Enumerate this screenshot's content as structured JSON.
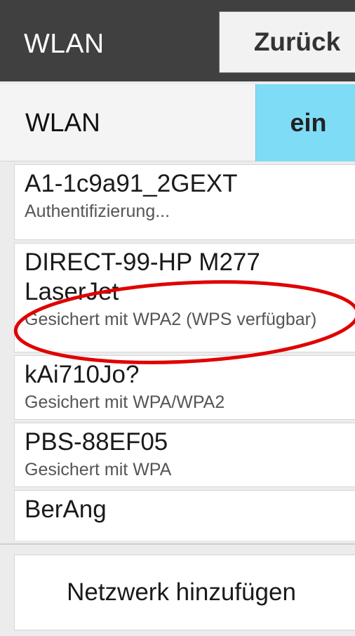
{
  "header": {
    "title": "WLAN",
    "back_label": "Zurück"
  },
  "wlan_toggle": {
    "label": "WLAN",
    "state_label": "ein",
    "accent_color": "#7fdcf6"
  },
  "networks": [
    {
      "name": "A1-1c9a91_2GEXT",
      "status": "Authentifizierung..."
    },
    {
      "name": "DIRECT-99-HP M277 LaserJet",
      "status": "Gesichert mit WPA2 (WPS verfügbar)"
    },
    {
      "name": "kAi710Jo?",
      "status": "Gesichert mit WPA/WPA2"
    },
    {
      "name": "PBS-88EF05",
      "status": "Gesichert mit WPA"
    },
    {
      "name": "BerAng",
      "status": ""
    }
  ],
  "add_network": {
    "label": "Netzwerk hinzufügen"
  },
  "annotation": {
    "shape": "ellipse",
    "color": "#e00000"
  }
}
